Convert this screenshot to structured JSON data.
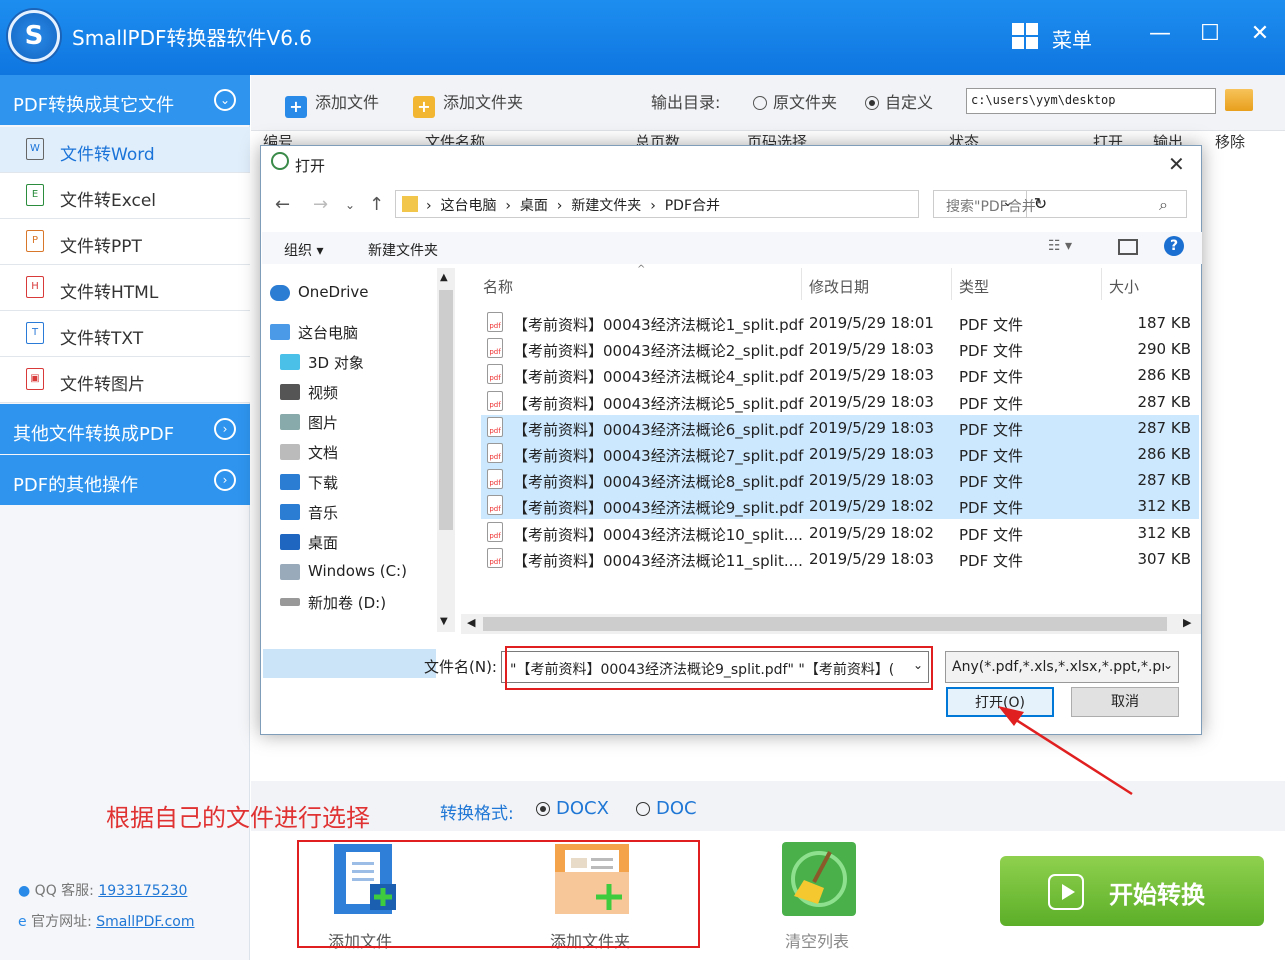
{
  "app": {
    "title": "SmallPDF转换器软件V6.6",
    "logo_letter": "S",
    "menu": "菜单",
    "min": "—",
    "max": "☐",
    "close": "✕"
  },
  "sidebar": {
    "pdf_to_other": "PDF转换成其它文件",
    "items": [
      {
        "label": "文件转Word",
        "icon": "W"
      },
      {
        "label": "文件转Excel",
        "icon": "E"
      },
      {
        "label": "文件转PPT",
        "icon": "P"
      },
      {
        "label": "文件转HTML",
        "icon": "H"
      },
      {
        "label": "文件转TXT",
        "icon": "T"
      },
      {
        "label": "文件转图片",
        "icon": "▣"
      }
    ],
    "other_to_pdf": "其他文件转换成PDF",
    "pdf_other_ops": "PDF的其他操作",
    "qq_label": "QQ 客服:",
    "qq": "1933175230",
    "site_label": "官方网址:",
    "site": "SmallPDF.com"
  },
  "toolbar": {
    "add_file": "添加文件",
    "add_folder": "添加文件夹",
    "output_label": "输出目录:",
    "opt_original": "原文件夹",
    "opt_custom": "自定义",
    "output_path": "c:\\users\\yym\\desktop"
  },
  "columns": {
    "index": "编号",
    "name": "文件名称",
    "pages": "总页数",
    "range": "页码选择",
    "status": "状态",
    "open": "打开",
    "output": "输出",
    "remove": "移除"
  },
  "bottom": {
    "annotation": "根据自己的文件进行选择",
    "format_label": "转换格式:",
    "docx": "DOCX",
    "doc": "DOC",
    "add_file": "添加文件",
    "add_folder": "添加文件夹",
    "clear": "清空列表",
    "start": "开始转换"
  },
  "dialog": {
    "title": "打开",
    "path": [
      "这台电脑",
      "桌面",
      "新建文件夹",
      "PDF合并"
    ],
    "search_placeholder": "搜索\"PDF合并\"",
    "organize": "组织 ▾",
    "new_folder": "新建文件夹",
    "nav": [
      "OneDrive",
      "这台电脑",
      "3D 对象",
      "视频",
      "图片",
      "文档",
      "下载",
      "音乐",
      "桌面",
      "Windows (C:)",
      "新加卷 (D:)"
    ],
    "headers": {
      "name": "名称",
      "date": "修改日期",
      "type": "类型",
      "size": "大小"
    },
    "files": [
      {
        "name": "【考前资料】00043经济法概论1_split.pdf",
        "date": "2019/5/29 18:01",
        "type": "PDF 文件",
        "size": "187 KB",
        "selected": false
      },
      {
        "name": "【考前资料】00043经济法概论2_split.pdf",
        "date": "2019/5/29 18:03",
        "type": "PDF 文件",
        "size": "290 KB",
        "selected": false
      },
      {
        "name": "【考前资料】00043经济法概论4_split.pdf",
        "date": "2019/5/29 18:03",
        "type": "PDF 文件",
        "size": "286 KB",
        "selected": false
      },
      {
        "name": "【考前资料】00043经济法概论5_split.pdf",
        "date": "2019/5/29 18:03",
        "type": "PDF 文件",
        "size": "287 KB",
        "selected": false
      },
      {
        "name": "【考前资料】00043经济法概论6_split.pdf",
        "date": "2019/5/29 18:03",
        "type": "PDF 文件",
        "size": "287 KB",
        "selected": true
      },
      {
        "name": "【考前资料】00043经济法概论7_split.pdf",
        "date": "2019/5/29 18:03",
        "type": "PDF 文件",
        "size": "286 KB",
        "selected": true
      },
      {
        "name": "【考前资料】00043经济法概论8_split.pdf",
        "date": "2019/5/29 18:03",
        "type": "PDF 文件",
        "size": "287 KB",
        "selected": true
      },
      {
        "name": "【考前资料】00043经济法概论9_split.pdf",
        "date": "2019/5/29 18:02",
        "type": "PDF 文件",
        "size": "312 KB",
        "selected": true
      },
      {
        "name": "【考前资料】00043经济法概论10_split....",
        "date": "2019/5/29 18:02",
        "type": "PDF 文件",
        "size": "312 KB",
        "selected": false
      },
      {
        "name": "【考前资料】00043经济法概论11_split....",
        "date": "2019/5/29 18:03",
        "type": "PDF 文件",
        "size": "307 KB",
        "selected": false
      }
    ],
    "filename_label": "文件名(N):",
    "filename_value": "\"【考前资料】00043经济法概论9_split.pdf\" \"【考前资料】(",
    "filetype": "Any(*.pdf,*.xls,*.xlsx,*.ppt,*.pı",
    "open": "打开(O)",
    "cancel": "取消"
  }
}
